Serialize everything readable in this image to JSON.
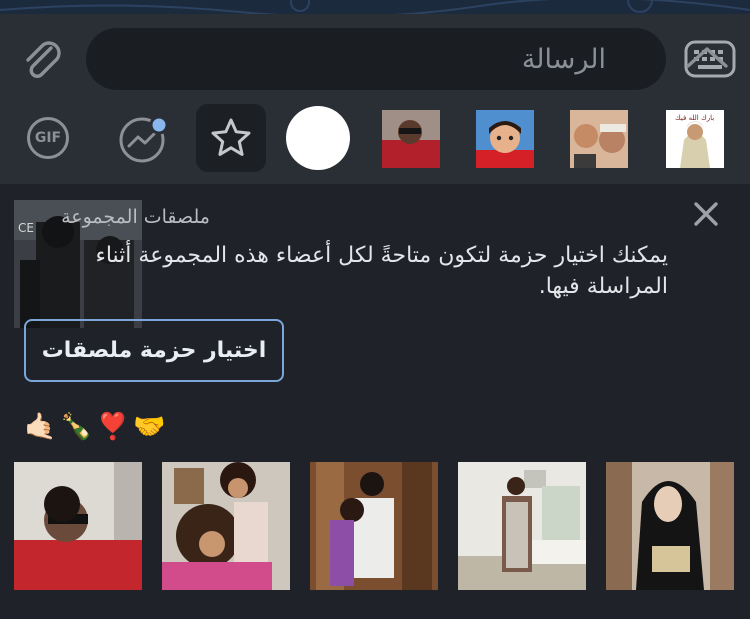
{
  "composer": {
    "placeholder": "الرسالة",
    "attach_icon": "paperclip-icon",
    "keyboard_icon": "keyboard-icon",
    "collapse_icon": "chevron-up-icon"
  },
  "tabs": {
    "gif_label": "GIF",
    "items": [
      "gif-tab",
      "trending-tab",
      "favorites-tab",
      "group-stickers-tab",
      "sticker-pack-1",
      "sticker-pack-2",
      "sticker-pack-3",
      "sticker-pack-4"
    ],
    "active": "favorites-tab",
    "sticker_pack_4_caption": "بارك الله فيك"
  },
  "group_panel": {
    "title": "ملصقات المجموعة",
    "description": "يمكنك اختيار حزمة لتكون متاحةً لكل أعضاء هذه المجموعة أثناء المراسلة فيها.",
    "choose_button": "اختيار حزمة ملصقات",
    "close_icon": "close-icon"
  },
  "emoji_row": "🤙🏻🍾❣️🤝",
  "gifs": [
    "gif-woman-sunglasses",
    "gif-two-women-laughing",
    "gif-women-door",
    "gif-woman-bedroom",
    "gif-woman-crying"
  ],
  "colors": {
    "background": "#1f2329",
    "bar": "#2a2e35",
    "accent": "#7aa7d8",
    "badge": "#8ab8ee"
  }
}
